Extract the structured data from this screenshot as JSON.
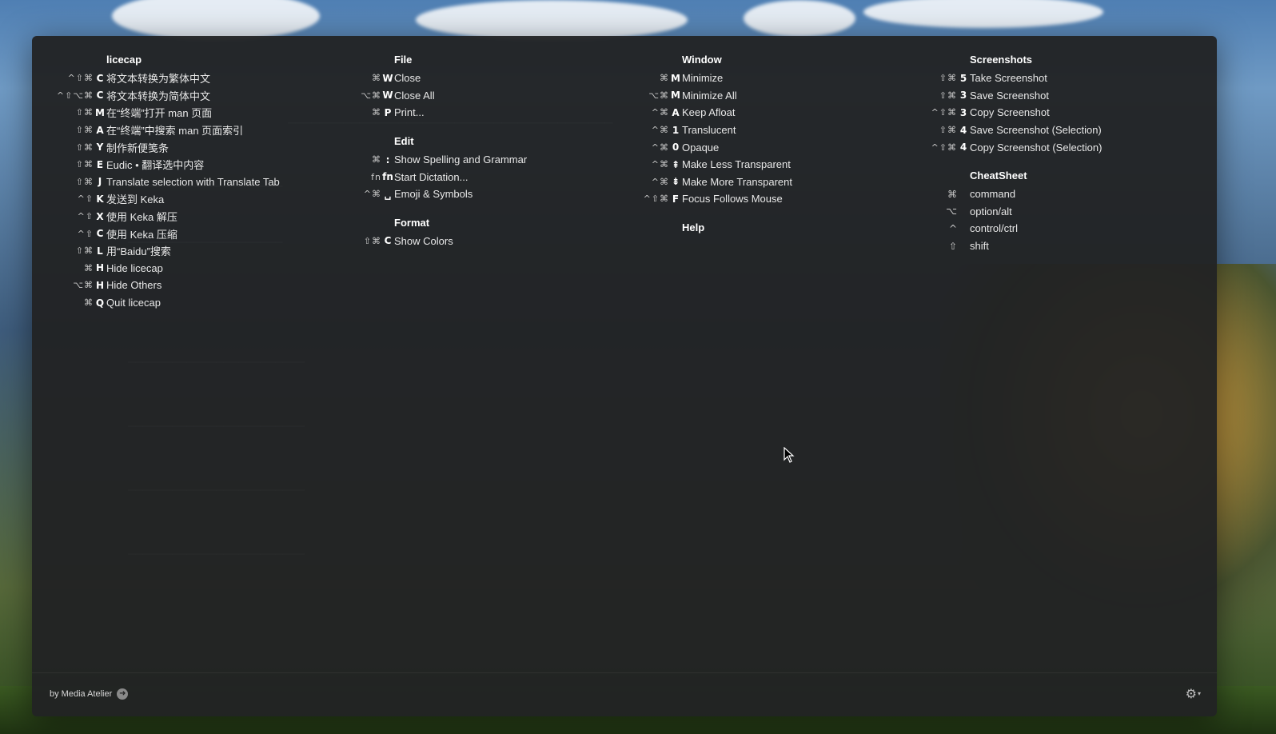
{
  "columns": [
    {
      "sections": [
        {
          "title": "licecap",
          "items": [
            {
              "mods": "^⇧⌘",
              "key": "C",
              "label": "将文本转换为繁体中文"
            },
            {
              "mods": "^⇧⌥⌘",
              "key": "C",
              "label": "将文本转换为简体中文"
            },
            {
              "mods": "⇧⌘",
              "key": "M",
              "label": "在“终端”打开 man 页面"
            },
            {
              "mods": "⇧⌘",
              "key": "A",
              "label": "在“终端”中搜索 man 页面索引"
            },
            {
              "mods": "⇧⌘",
              "key": "Y",
              "label": "制作新便笺条"
            },
            {
              "mods": "⇧⌘",
              "key": "E",
              "label": "Eudic • 翻译选中内容"
            },
            {
              "mods": "⇧⌘",
              "key": "J",
              "label": "Translate selection with Translate Tab"
            },
            {
              "mods": "^⇧",
              "key": "K",
              "label": "发送到 Keka"
            },
            {
              "mods": "^⇧",
              "key": "X",
              "label": "使用 Keka 解压"
            },
            {
              "mods": "^⇧",
              "key": "C",
              "label": "使用 Keka 压缩"
            },
            {
              "mods": "⇧⌘",
              "key": "L",
              "label": "用“Baidu”搜索"
            },
            {
              "mods": "⌘",
              "key": "H",
              "label": "Hide licecap"
            },
            {
              "mods": "⌥⌘",
              "key": "H",
              "label": "Hide Others"
            },
            {
              "mods": "⌘",
              "key": "Q",
              "label": "Quit licecap"
            }
          ]
        }
      ]
    },
    {
      "sections": [
        {
          "title": "File",
          "items": [
            {
              "mods": "⌘",
              "key": "W",
              "label": "Close"
            },
            {
              "mods": "⌥⌘",
              "key": "W",
              "label": "Close All"
            },
            {
              "mods": "⌘",
              "key": "P",
              "label": "Print..."
            }
          ]
        },
        {
          "title": "Edit",
          "items": [
            {
              "mods": "⌘",
              "key": ":",
              "label": "Show Spelling and Grammar"
            },
            {
              "mods": "fn",
              "key": "fn",
              "label": "Start Dictation..."
            },
            {
              "mods": "^⌘",
              "key": "␣",
              "label": "Emoji & Symbols"
            }
          ]
        },
        {
          "title": "Format",
          "items": [
            {
              "mods": "⇧⌘",
              "key": "C",
              "label": "Show Colors"
            }
          ]
        }
      ]
    },
    {
      "sections": [
        {
          "title": "Window",
          "items": [
            {
              "mods": "⌘",
              "key": "M",
              "label": "Minimize"
            },
            {
              "mods": "⌥⌘",
              "key": "M",
              "label": "Minimize All"
            },
            {
              "mods": "^⌘",
              "key": "A",
              "label": "Keep Afloat"
            },
            {
              "mods": "^⌘",
              "key": "1",
              "label": "Translucent"
            },
            {
              "mods": "^⌘",
              "key": "0",
              "label": "Opaque"
            },
            {
              "mods": "^⌘",
              "key": "⇞",
              "label": "Make Less Transparent"
            },
            {
              "mods": "^⌘",
              "key": "⇟",
              "label": "Make More Transparent"
            },
            {
              "mods": "^⇧⌘",
              "key": "F",
              "label": "Focus Follows Mouse"
            }
          ]
        },
        {
          "title": "Help",
          "items": []
        }
      ]
    },
    {
      "sections": [
        {
          "title": "Screenshots",
          "items": [
            {
              "mods": "⇧⌘",
              "key": "5",
              "label": "Take Screenshot"
            },
            {
              "mods": "⇧⌘",
              "key": "3",
              "label": "Save Screenshot"
            },
            {
              "mods": "^⇧⌘",
              "key": "3",
              "label": "Copy Screenshot"
            },
            {
              "mods": "⇧⌘",
              "key": "4",
              "label": "Save Screenshot (Selection)"
            },
            {
              "mods": "^⇧⌘",
              "key": "4",
              "label": "Copy Screenshot (Selection)"
            }
          ]
        },
        {
          "title": "CheatSheet",
          "legend": [
            {
              "symbol": "⌘",
              "label": "command"
            },
            {
              "symbol": "⌥",
              "label": "option/alt"
            },
            {
              "symbol": "^",
              "label": "control/ctrl"
            },
            {
              "symbol": "⇧",
              "label": "shift"
            }
          ]
        }
      ]
    }
  ],
  "footer": {
    "brand": "by Media Atelier",
    "brand_icon": "arrow-circle-icon",
    "settings_icon": "gear-icon"
  },
  "colors": {
    "overlay": "#212224",
    "text": "#e8e8e8"
  }
}
